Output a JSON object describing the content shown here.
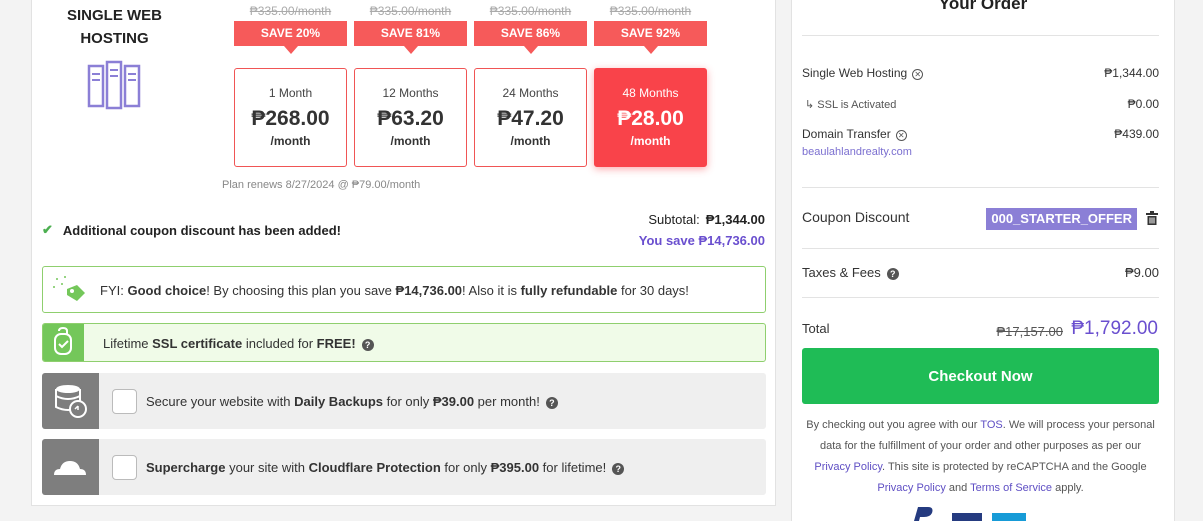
{
  "product": {
    "title": "SINGLE WEB HOSTING",
    "icon": "server-icon"
  },
  "plans": [
    {
      "old_price": "₱335.00/month",
      "save": "SAVE 20%",
      "term": "1 Month",
      "price": "₱268.00",
      "per": "/month",
      "selected": false
    },
    {
      "old_price": "₱335.00/month",
      "save": "SAVE 81%",
      "term": "12 Months",
      "price": "₱63.20",
      "per": "/month",
      "selected": false
    },
    {
      "old_price": "₱335.00/month",
      "save": "SAVE 86%",
      "term": "24 Months",
      "price": "₱47.20",
      "per": "/month",
      "selected": false
    },
    {
      "old_price": "₱335.00/month",
      "save": "SAVE 92%",
      "term": "48 Months",
      "price": "₱28.00",
      "per": "/month",
      "selected": true
    }
  ],
  "renew_note": "Plan renews 8/27/2024 @ ₱79.00/month",
  "coupon_added": "Additional coupon discount has been added!",
  "summary": {
    "subtotal_label": "Subtotal:",
    "subtotal_value": "₱1,344.00",
    "you_save": "You save ₱14,736.00"
  },
  "fyi": {
    "prefix": "FYI: ",
    "choice": "Good choice",
    "part2": "! By choosing this plan you save ",
    "amount": "₱14,736.00",
    "part3": "! Also it is ",
    "refundable": "fully refundable",
    "part4": " for 30 days!"
  },
  "ssl": {
    "prefix": "Lifetime ",
    "bold": "SSL certificate",
    "middle": " included for ",
    "free": "FREE!"
  },
  "addons": [
    {
      "icon": "database-backup-icon",
      "p1": "Secure your website with ",
      "b1": "Daily Backups",
      "p2": " for only ",
      "b2": "₱39.00",
      "p3": " per month!",
      "checked": false
    },
    {
      "icon": "cloud-icon",
      "b0": "Supercharge",
      "p1": " your site with ",
      "b1": "Cloudflare Protection",
      "p2": " for only ",
      "b2": "₱395.00",
      "p3": " for lifetime!",
      "checked": false
    }
  ],
  "order": {
    "title": "Your Order",
    "hosting_label": "Single Web Hosting",
    "hosting_value": "₱1,344.00",
    "ssl_label": "↳ SSL is Activated",
    "ssl_value": "₱0.00",
    "domain_label": "Domain Transfer",
    "domain_value": "₱439.00",
    "domain_name": "beaulahlandrealty.com",
    "coupon_label": "Coupon Discount",
    "coupon_code": "000_STARTER_OFFER",
    "taxes_label": "Taxes & Fees",
    "taxes_value": "₱9.00",
    "total_label": "Total",
    "total_old": "₱17,157.00",
    "total_new": "₱1,792.00",
    "checkout": "Checkout Now"
  },
  "legal": {
    "t1": "By checking out you agree with our ",
    "tos": "TOS",
    "t2": ". We will process your personal data for the fulfillment of your order and other purposes as per our ",
    "privacy1": "Privacy Policy",
    "t3": ". This site is protected by reCAPTCHA and the Google ",
    "privacy2": "Privacy Policy",
    "t4": " and ",
    "terms": "Terms of Service",
    "t5": " apply."
  },
  "colors": {
    "accent_red": "#f65a5a",
    "selected_red": "#f9434a",
    "purple": "#6a4fcf",
    "green": "#1fbc56"
  }
}
